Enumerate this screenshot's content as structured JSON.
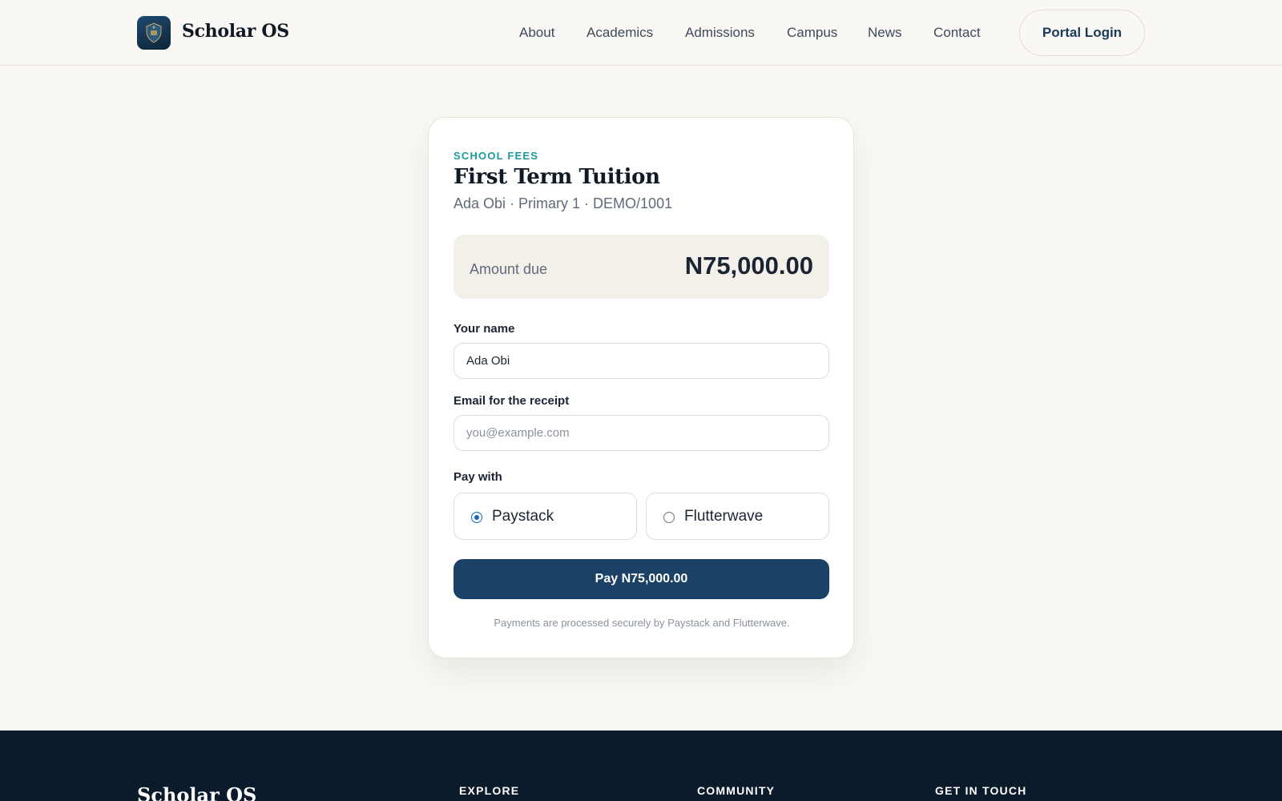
{
  "header": {
    "brand": "Scholar OS",
    "nav": [
      "About",
      "Academics",
      "Admissions",
      "Campus",
      "News",
      "Contact"
    ],
    "login_label": "Portal Login"
  },
  "card": {
    "eyebrow": "SCHOOL FEES",
    "title": "First Term Tuition",
    "subtitle": "Ada Obi · Primary 1 · DEMO/1001",
    "amount_label": "Amount due",
    "amount_value": "N75,000.00",
    "name_label": "Your name",
    "name_value": "Ada Obi",
    "email_label": "Email for the receipt",
    "email_placeholder": "you@example.com",
    "pay_with_label": "Pay with",
    "methods": [
      {
        "label": "Paystack",
        "selected": true
      },
      {
        "label": "Flutterwave",
        "selected": false
      }
    ],
    "pay_button": "Pay N75,000.00",
    "note": "Payments are processed securely by Paystack and Flutterwave."
  },
  "footer": {
    "brand": "Scholar OS",
    "headings": [
      "EXPLORE",
      "COMMUNITY",
      "GET IN TOUCH"
    ]
  },
  "colors": {
    "background": "#faf8f4",
    "primary": "#1b4167",
    "accent": "#1a9a9c",
    "footer": "#0c1b2b"
  }
}
